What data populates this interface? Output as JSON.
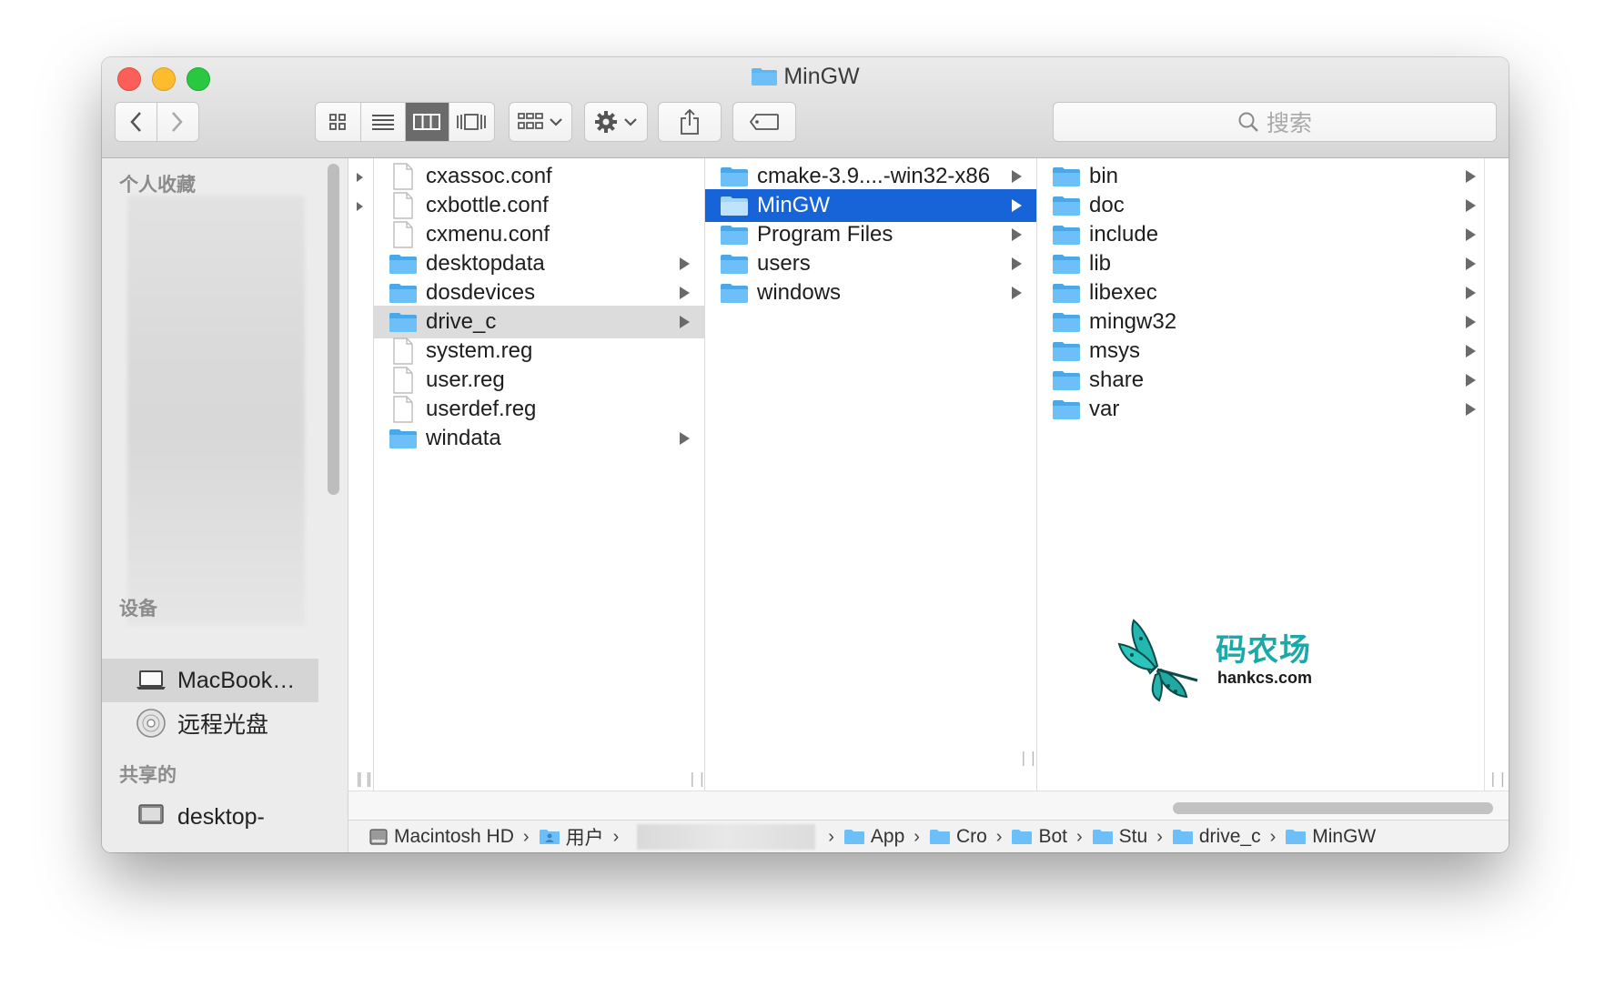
{
  "window": {
    "title": "MinGW"
  },
  "toolbar": {
    "search_placeholder": "搜索",
    "view_modes": [
      "icon-view",
      "list-view",
      "column-view",
      "cover-flow-view"
    ],
    "active_view": "column-view"
  },
  "sidebar": {
    "favorites_heading": "个人收藏",
    "devices_heading": "设备",
    "shared_heading": "共享的",
    "devices": [
      {
        "label": "MacBook…",
        "icon": "laptop-icon",
        "selected": true
      },
      {
        "label": "远程光盘",
        "icon": "disc-icon",
        "selected": false
      }
    ],
    "shared": [
      {
        "label": "desktop-",
        "icon": "computer-icon"
      }
    ]
  },
  "columns": [
    {
      "items": [
        {
          "label": "cxassoc.conf",
          "type": "file"
        },
        {
          "label": "cxbottle.conf",
          "type": "file"
        },
        {
          "label": "cxmenu.conf",
          "type": "file"
        },
        {
          "label": "desktopdata",
          "type": "folder"
        },
        {
          "label": "dosdevices",
          "type": "folder"
        },
        {
          "label": "drive_c",
          "type": "folder",
          "state": "path-selected"
        },
        {
          "label": "system.reg",
          "type": "file"
        },
        {
          "label": "user.reg",
          "type": "file"
        },
        {
          "label": "userdef.reg",
          "type": "file"
        },
        {
          "label": "windata",
          "type": "folder"
        }
      ]
    },
    {
      "items": [
        {
          "label": "cmake-3.9....-win32-x86",
          "type": "folder"
        },
        {
          "label": "MinGW",
          "type": "folder",
          "state": "selected"
        },
        {
          "label": "Program Files",
          "type": "folder"
        },
        {
          "label": "users",
          "type": "folder"
        },
        {
          "label": "windows",
          "type": "folder"
        }
      ]
    },
    {
      "items": [
        {
          "label": "bin",
          "type": "folder"
        },
        {
          "label": "doc",
          "type": "folder"
        },
        {
          "label": "include",
          "type": "folder"
        },
        {
          "label": "lib",
          "type": "folder"
        },
        {
          "label": "libexec",
          "type": "folder"
        },
        {
          "label": "mingw32",
          "type": "folder"
        },
        {
          "label": "msys",
          "type": "folder"
        },
        {
          "label": "share",
          "type": "folder"
        },
        {
          "label": "var",
          "type": "folder"
        }
      ]
    }
  ],
  "pathbar": {
    "items": [
      "Macintosh HD",
      "用户",
      "App",
      "Cro",
      "Bot",
      "Stu",
      "drive_c",
      "MinGW"
    ]
  },
  "watermark": {
    "title": "码农场",
    "url": "hankcs.com"
  },
  "colors": {
    "selection_blue": "#1764d8",
    "folder_blue": "#5fb6f2",
    "watermark_teal": "#1aa8a8"
  }
}
